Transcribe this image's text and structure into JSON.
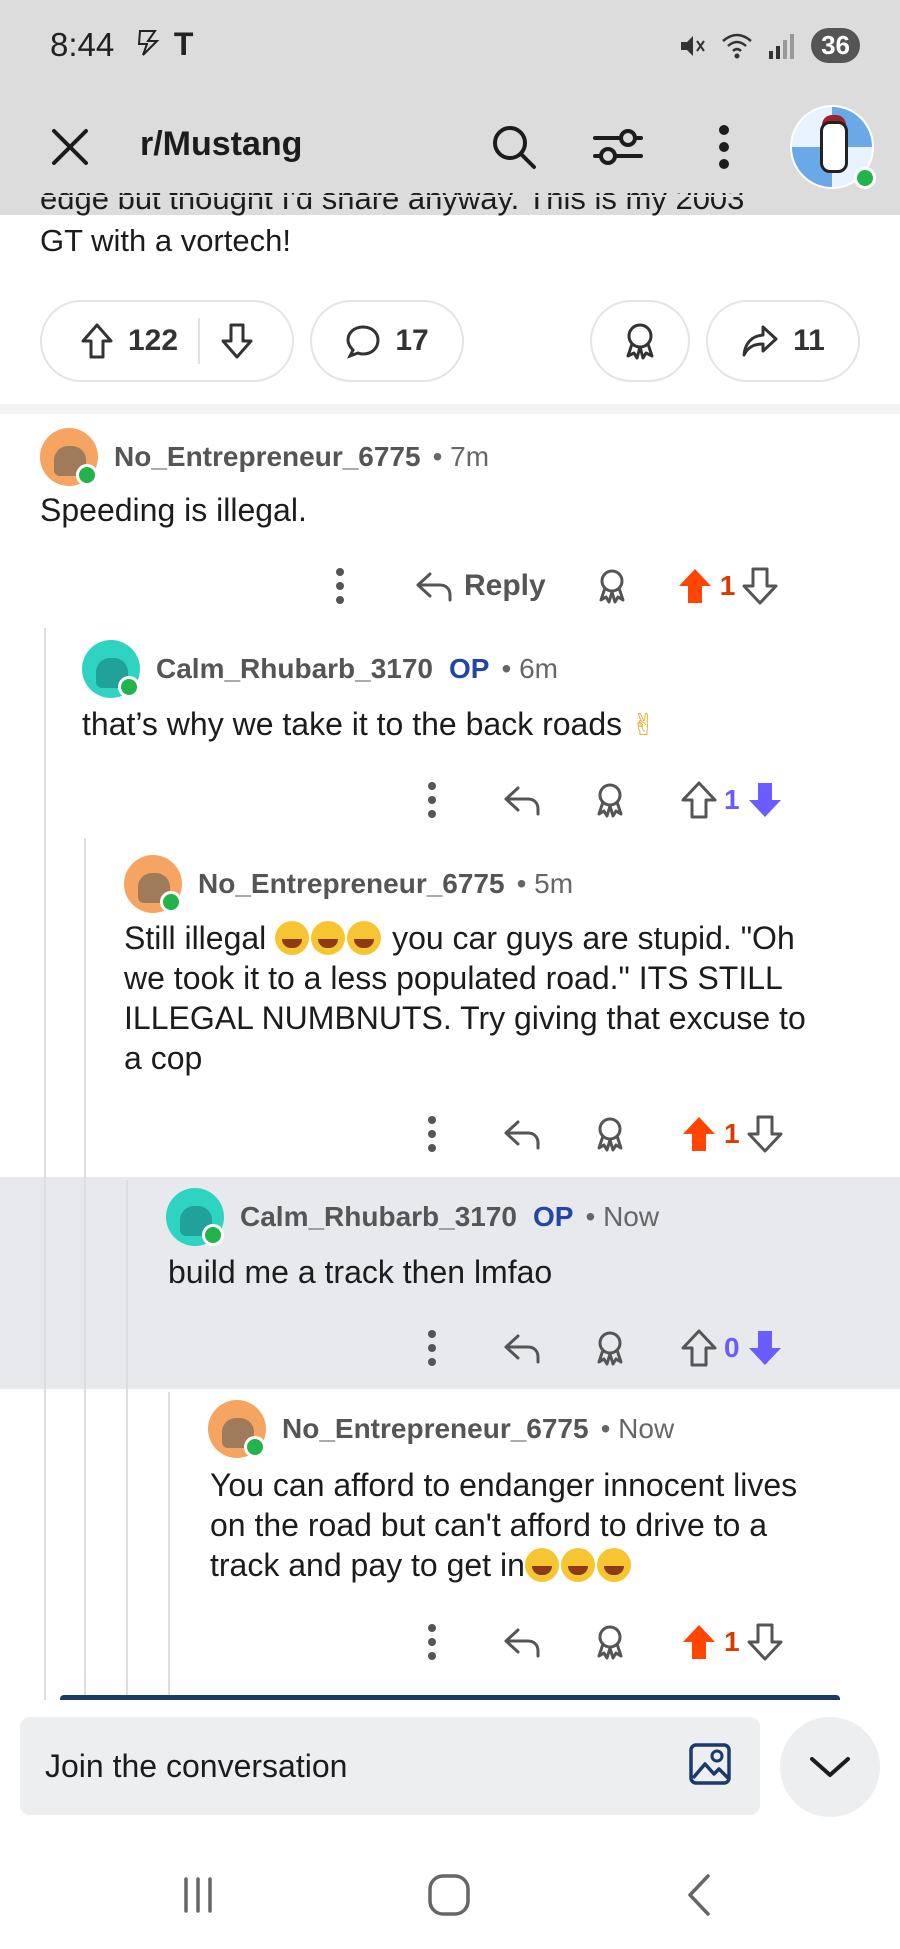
{
  "status_bar": {
    "time": "8:44",
    "carrier_glyph": "T",
    "battery": "36"
  },
  "header": {
    "title": "r/Mustang"
  },
  "post": {
    "text_line1": "edge but thought I'd share anyway. This is my 2003",
    "text_line2": "GT with a vortech!",
    "upvotes": "122",
    "comments": "17",
    "shares": "11"
  },
  "comments": [
    {
      "username": "No_Entrepreneur_6775",
      "op": "",
      "time": "• 7m",
      "body": "Speeding is illegal.",
      "reply_label": "Reply",
      "votes": "1",
      "vote_state": "up"
    },
    {
      "username": "Calm_Rhubarb_3170",
      "op": "OP",
      "time": "• 6m",
      "body": "that’s why we take it to the back roads",
      "votes": "1",
      "vote_state": "down"
    },
    {
      "username": "No_Entrepreneur_6775",
      "op": "",
      "time": "• 5m",
      "body_prefix": "Still illegal",
      "body_line1_rest": "you car guys are stupid. \"Oh",
      "body_line2": "we took it to a less populated road.\" ITS STILL",
      "body_line3": "ILLEGAL NUMBNUTS. Try giving that excuse to",
      "body_line4": "a cop",
      "votes": "1",
      "vote_state": "up"
    },
    {
      "username": "Calm_Rhubarb_3170",
      "op": "OP",
      "time": "• Now",
      "body": "build me a track then lmfao",
      "votes": "0",
      "vote_state": "down"
    },
    {
      "username": "No_Entrepreneur_6775",
      "op": "",
      "time": "• Now",
      "body_line1": "You can afford to endanger innocent lives",
      "body_line2": "on the road but can't afford to drive to a",
      "body_line3": "track and pay to get in",
      "votes": "1",
      "vote_state": "up"
    }
  ],
  "composer": {
    "placeholder": "Join the conversation"
  },
  "colors": {
    "upvote": "#ff4500",
    "downvote": "#6a5cff",
    "op": "#2146a6",
    "highlight": "#e7e9ec"
  }
}
